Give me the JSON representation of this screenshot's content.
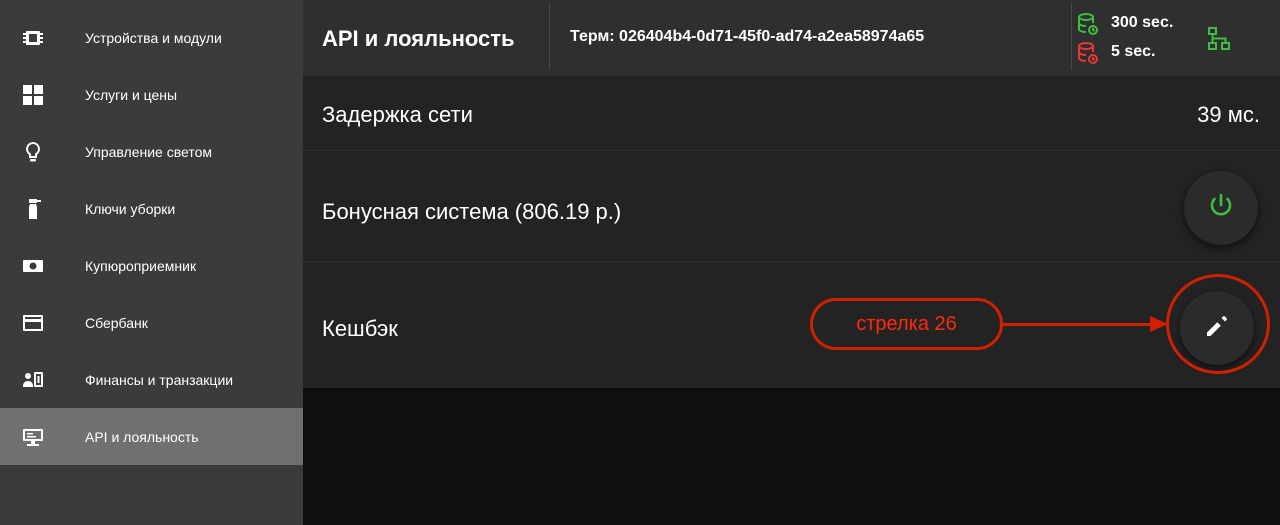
{
  "sidebar": {
    "items": [
      {
        "label": "Устройства и модули",
        "icon": "chip-icon"
      },
      {
        "label": "Услуги и цены",
        "icon": "grid-icon"
      },
      {
        "label": "Управление светом",
        "icon": "lightbulb-icon"
      },
      {
        "label": "Ключи уборки",
        "icon": "spray-bottle-icon"
      },
      {
        "label": "Купюроприемник",
        "icon": "banknote-icon"
      },
      {
        "label": "Сбербанк",
        "icon": "credit-card-icon"
      },
      {
        "label": "Финансы и транзакции",
        "icon": "finance-icon"
      },
      {
        "label": "API и лояльность",
        "icon": "api-monitor-icon",
        "active": true
      }
    ]
  },
  "header": {
    "title": "API и лояльность",
    "terminal": "Терм: 026404b4-0d71-45f0-ad74-a2ea58974a65",
    "status": [
      {
        "text": "300 sec.",
        "color": "#3fbf3f",
        "icon": "database-sync-icon"
      },
      {
        "text": "5 sec.",
        "color": "#e53935",
        "icon": "database-sync-icon"
      }
    ],
    "network_icon": "network-icon",
    "network_color": "#3fbf3f"
  },
  "rows": [
    {
      "label": "Задержка сети",
      "value": "39 мс."
    },
    {
      "label": "Бонусная система (806.19 р.)",
      "action_icon": "power-icon",
      "action_color": "#3fbf3f"
    },
    {
      "label": "Кешбэк",
      "action_icon": "pencil-icon",
      "action_color": "#ffffff"
    }
  ],
  "annotation": {
    "text": "стрелка 26",
    "color": "#d02000"
  }
}
